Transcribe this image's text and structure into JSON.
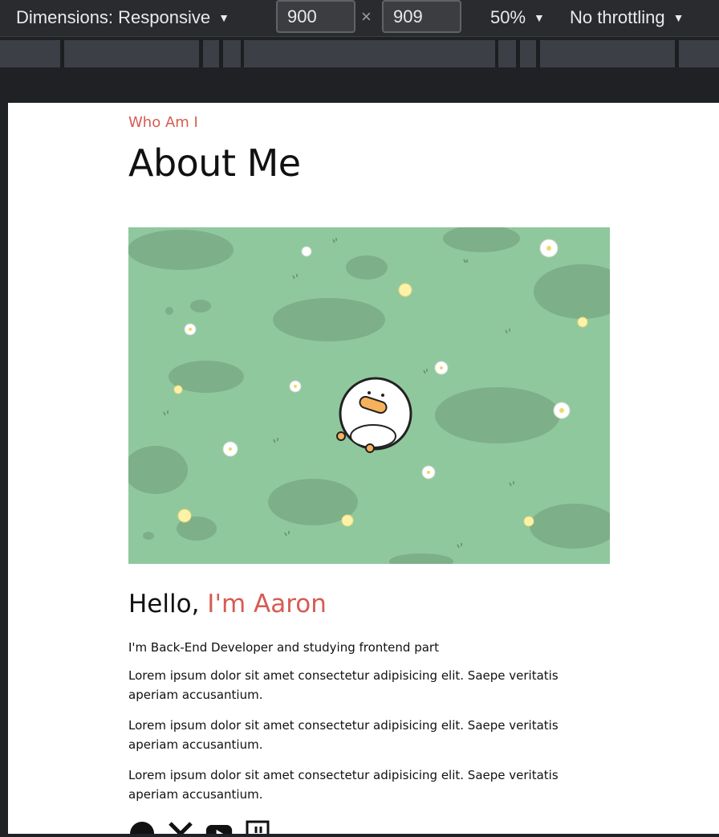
{
  "devtools": {
    "dimensions_label": "Dimensions: Responsive",
    "width_value": "900",
    "height_value": "909",
    "times_symbol": "×",
    "zoom_label": "50%",
    "throttling_label": "No throttling",
    "dropdown_arrow": "▼"
  },
  "page": {
    "kicker": "Who Am I",
    "title": "About Me",
    "hello_prefix": "Hello, ",
    "hello_name": "I'm Aaron",
    "intro": "I'm Back-End Developer and studying frontend part",
    "paragraphs": [
      "Lorem ipsum dolor sit amet consectetur adipisicing elit. Saepe veritatis aperiam accusantium.",
      "Lorem ipsum dolor sit amet consectetur adipisicing elit. Saepe veritatis aperiam accusantium.",
      "Lorem ipsum dolor sit amet consectetur adipisicing elit. Saepe veritatis aperiam accusantium."
    ],
    "socials": [
      "github-icon",
      "x-icon",
      "youtube-icon",
      "twitch-icon"
    ]
  },
  "colors": {
    "accent": "#d65b52",
    "grass": "#90c89e",
    "bush": "#7daf88"
  }
}
